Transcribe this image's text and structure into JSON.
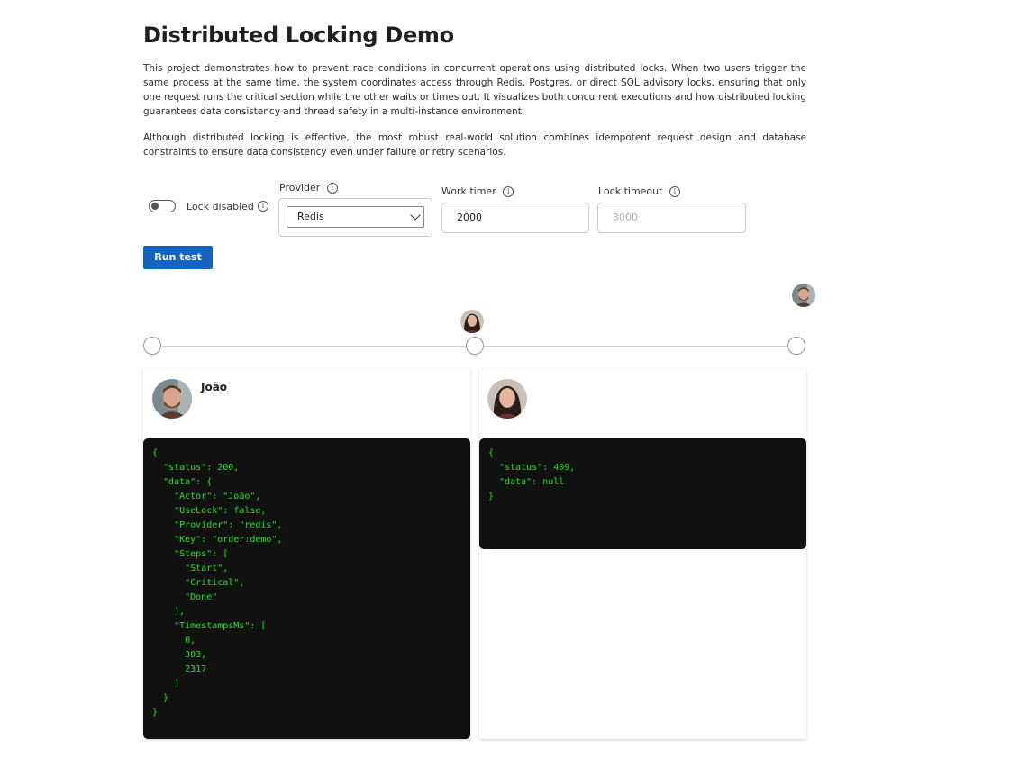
{
  "header": {
    "title": "Distributed Locking Demo",
    "description_1": "This project demonstrates how to prevent race conditions in concurrent operations using distributed locks. When two users trigger the same process at the same time, the system coordinates access through Redis, Postgres, or direct SQL advisory locks, ensuring that only one request runs the critical section while the other waits or times out. It visualizes both concurrent executions and how distributed locking guarantees data consistency and thread safety in a multi-instance environment.",
    "description_2": "Although distributed locking is effective, the most robust real-world solution combines idempotent request design and database constraints to ensure data consistency even under failure or retry scenarios."
  },
  "controls": {
    "lock_toggle": {
      "label": "Lock disabled",
      "enabled": false
    },
    "provider": {
      "label": "Provider",
      "selected": "Redis"
    },
    "work_timer": {
      "label": "Work timer",
      "value": "2000"
    },
    "lock_timeout": {
      "label": "Lock timeout",
      "placeholder": "3000"
    },
    "run_button": "Run test",
    "info_glyph": "i"
  },
  "results": [
    {
      "actor": "João",
      "json": "{\n  \"status\": 200,\n  \"data\": {\n    \"Actor\": \"João\",\n    \"UseLock\": false,\n    \"Provider\": \"redis\",\n    \"Key\": \"order:demo\",\n    \"Steps\": [\n      \"Start\",\n      \"Critical\",\n      \"Done\"\n    ],\n    \"TimestampsMs\": [\n      0,\n      303,\n      2317\n    ]\n  }\n}"
    },
    {
      "actor": "",
      "json": "{\n  \"status\": 409,\n  \"data\": null\n}"
    }
  ],
  "theme": {
    "accent": "#1565c0",
    "code_background": "#111111",
    "code_text": "#1ee61e"
  }
}
